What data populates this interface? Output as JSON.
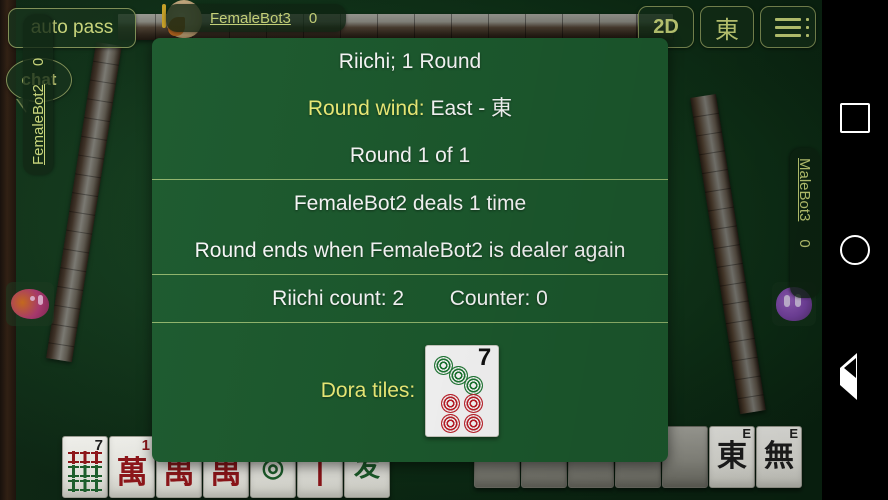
{
  "hud": {
    "auto_pass_label": "auto pass",
    "chat_label": "chat",
    "view_mode_label": "2D",
    "round_wind_button_label": "東",
    "menu_icon": "hamburger-menu-icon"
  },
  "players": {
    "top": {
      "name": "FemaleBot3",
      "score": "0",
      "avatar": "female-avatar"
    },
    "left": {
      "name": "FemaleBot2",
      "score": "0",
      "avatar": "female-avatar"
    },
    "right": {
      "name": "MaleBot3",
      "score": "0",
      "avatar": "male-avatar"
    }
  },
  "dialog": {
    "rule_line": "Riichi; 1 Round",
    "round_wind_label": "Round wind:",
    "round_wind_value": "East - 東",
    "round_progress": "Round 1 of 1",
    "dealer_line": "FemaleBot2 deals 1 time",
    "round_end_line": "Round ends when FemaleBot2 is dealer again",
    "riichi_count_label": "Riichi count: 2",
    "counter_label": "Counter: 0",
    "dora_label": "Dora tiles:",
    "dora_tile": {
      "suit": "circles",
      "value": "7",
      "number_glyph": "7"
    }
  },
  "hand_tiles": [
    {
      "label": "7",
      "suit": "bamboo",
      "number_glyph": "7"
    },
    {
      "label": "1",
      "suit": "characters",
      "face": "萬",
      "number_glyph": "1"
    },
    {
      "label": "",
      "suit": "characters",
      "face": "禺",
      "number_glyph": ""
    },
    {
      "label": "",
      "suit": "characters",
      "face": "禺",
      "number_glyph": ""
    },
    {
      "label": "",
      "suit": "circles",
      "face": "◎",
      "number_glyph": ""
    },
    {
      "label": "",
      "suit": "bamboo",
      "face": "丨",
      "number_glyph": ""
    },
    {
      "label": "",
      "suit": "characters",
      "face": "发",
      "number_glyph": ""
    }
  ],
  "discard_tiles": [
    {
      "face": "東",
      "corner": "E"
    },
    {
      "face": "無",
      "corner": "E"
    }
  ],
  "navbar": {
    "recents_icon": "square-recents-icon",
    "home_icon": "circle-home-icon",
    "back_icon": "triangle-back-icon"
  },
  "colors": {
    "dialog_bg": "#1d5c2f",
    "accent_yellow": "#f2f27a",
    "button_text": "#c9d67a",
    "divider": "#a9c97a"
  }
}
